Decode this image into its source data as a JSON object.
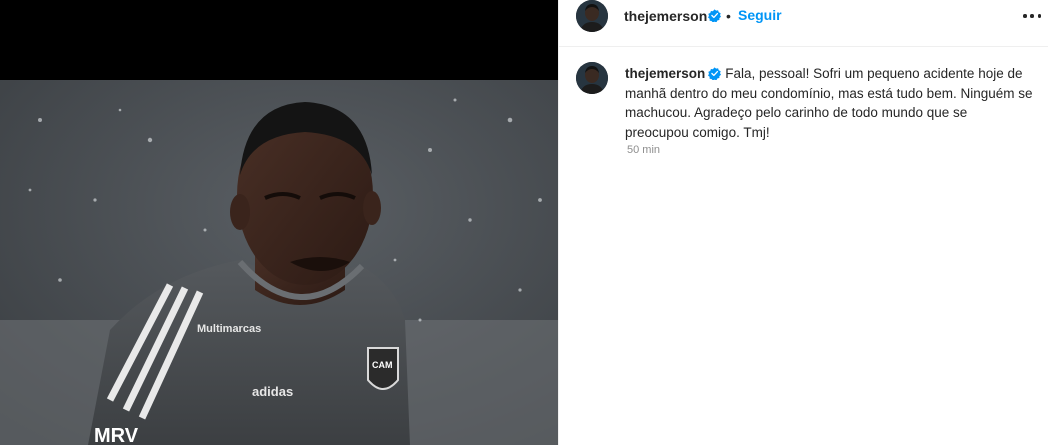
{
  "post": {
    "image_alt": "Jogador com camisa de treino cinza do Atlético-MG",
    "shirt_sponsor_top": "Multimarcas",
    "shirt_brand": "adidas",
    "shirt_sponsor_bottom": "MRV",
    "shirt_crest": "CAM"
  },
  "header": {
    "username": "thejemerson",
    "dot": "•",
    "follow_label": "Seguir",
    "more_icon": "more-horizontal-icon",
    "verified_icon": "verified-badge-icon"
  },
  "caption": {
    "username": "thejemerson",
    "text": "Fala, pessoal! Sofri um pequeno acidente hoje de manhã dentro do meu condomínio, mas está tudo bem. Ninguém se machucou. Agradeço pelo carinho de todo mundo que se preocupou comigo. Tmj!",
    "timestamp": "50 min"
  },
  "colors": {
    "accent": "#0095f6",
    "text_primary": "#262626",
    "text_secondary": "#8e8e8e",
    "divider": "#efefef"
  }
}
